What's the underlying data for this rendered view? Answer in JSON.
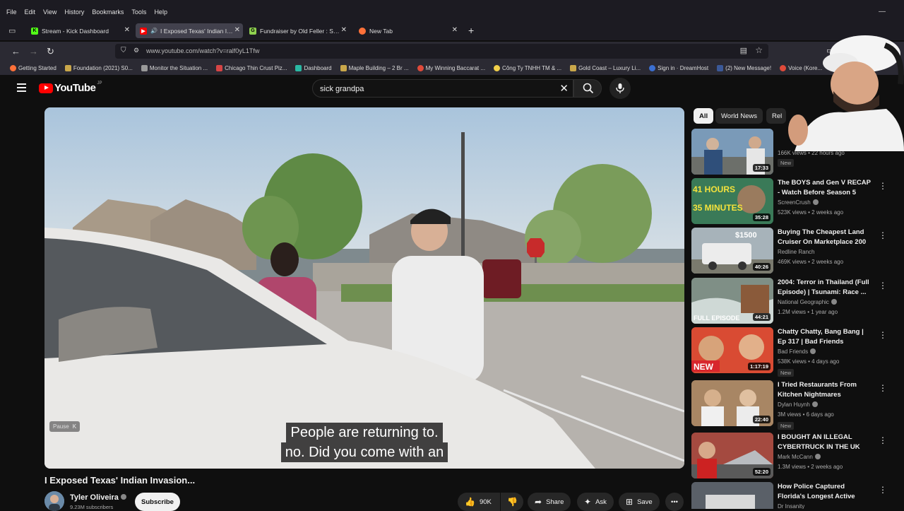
{
  "browser": {
    "menu": [
      "File",
      "Edit",
      "View",
      "History",
      "Bookmarks",
      "Tools",
      "Help"
    ],
    "tabs": [
      {
        "title": "Stream - Kick Dashboard",
        "favicon_color": "#53fc18",
        "favicon_char": "K"
      },
      {
        "title": "I Exposed Texas' Indian Invasion",
        "favicon_color": "#ff0000",
        "favicon_char": "▶",
        "active": true,
        "audio": "🔊"
      },
      {
        "title": "Fundraiser by Old Feller : Supp",
        "favicon_color": "#8fd14f",
        "favicon_char": "G"
      },
      {
        "title": "New Tab",
        "favicon_color": "#ff7139",
        "favicon_char": ""
      }
    ],
    "new_tab_icon": "+",
    "url": "www.youtube.com/watch?v=ralf0yL1Tfw",
    "bookmarks": [
      {
        "label": "Getting Started",
        "color": "#ff7139"
      },
      {
        "label": "Foundation (2021) S0...",
        "color": "#c9a74a"
      },
      {
        "label": "Monitor the Situation ...",
        "color": "#999999"
      },
      {
        "label": "Chicago Thin Crust Piz...",
        "color": "#d64545"
      },
      {
        "label": "Dashboard",
        "color": "#2ab8a3"
      },
      {
        "label": "Maple Building – 2 Br ...",
        "color": "#c9a74a"
      },
      {
        "label": "My Winning Baccarat ...",
        "color": "#e04a3a"
      },
      {
        "label": "Công Ty TNHH TM & ...",
        "color": "#f2d04a"
      },
      {
        "label": "Gold Coast – Luxury Li...",
        "color": "#c9a74a"
      },
      {
        "label": "Sign in · DreamHost",
        "color": "#3b6fd1"
      },
      {
        "label": "(2) New Message!",
        "color": "#3b5998"
      },
      {
        "label": "Voice (Kore...",
        "color": "#e04a3a"
      }
    ]
  },
  "youtube": {
    "logo_text": "YouTube",
    "country_code": "JP",
    "search_value": "sick grandpa",
    "chips": [
      "All",
      "World News",
      "Rel"
    ],
    "video": {
      "title": "I Exposed Texas' Indian Invasion...",
      "channel": "Tyler Oliveira",
      "subscribers": "9.23M subscribers",
      "subscribe_label": "Subscribe",
      "likes": "90K",
      "share_label": "Share",
      "ask_label": "Ask",
      "save_label": "Save",
      "pause_hint": "Pause",
      "pause_key": "K",
      "subtitle_line1": "People are returning to.",
      "subtitle_line2": "no.  Did you come with an"
    },
    "recommendations": [
      {
        "title": "",
        "channel": "",
        "meta": "166K views • 22 hours ago",
        "duration": "17:33",
        "badge": "New",
        "thumb": "#5b7fa6"
      },
      {
        "title": "The BOYS and Gen V RECAP - Watch Before Season 5",
        "channel": "ScreenCrush",
        "meta": "523K views • 2 weeks ago",
        "duration": "35:28",
        "badge": "",
        "thumb": "#2c6b4a",
        "overlay": "41 HOURS 35 MINUTES"
      },
      {
        "title": "Buying The Cheapest Land Cruiser On Marketplace 200 ...",
        "channel": "Redline Ranch",
        "meta": "469K views • 2 weeks ago",
        "duration": "40:26",
        "badge": "",
        "thumb": "#8c9aa3",
        "overlay": "$1500"
      },
      {
        "title": "2004: Terror in Thailand (Full Episode) | Tsunami: Race ...",
        "channel": "National Geographic",
        "meta": "1.2M views • 1 year ago",
        "duration": "44:21",
        "badge": "",
        "thumb": "#6a7d6e",
        "overlay": "FULL EPISODE"
      },
      {
        "title": "Chatty Chatty, Bang Bang | Ep 317 | Bad Friends",
        "channel": "Bad Friends",
        "meta": "538K views • 4 days ago",
        "duration": "1:17:19",
        "badge": "New",
        "thumb": "#d33b2c",
        "overlay": "NEW"
      },
      {
        "title": "I Tried Restaurants From Kitchen Nightmares",
        "channel": "Dylan Huynh",
        "meta": "3M views • 6 days ago",
        "duration": "22:40",
        "badge": "New",
        "thumb": "#9a7a5a"
      },
      {
        "title": "I BOUGHT AN ILLEGAL CYBERTRUCK IN THE UK",
        "channel": "Mark McCann",
        "meta": "1.3M views • 2 weeks ago",
        "duration": "52:20",
        "badge": "",
        "thumb": "#b04040"
      },
      {
        "title": "How Police Captured Florida's Longest Active Serial Killer",
        "channel": "Dr Insanity",
        "meta": "",
        "duration": "",
        "badge": "",
        "thumb": "#4a4f57"
      }
    ]
  }
}
